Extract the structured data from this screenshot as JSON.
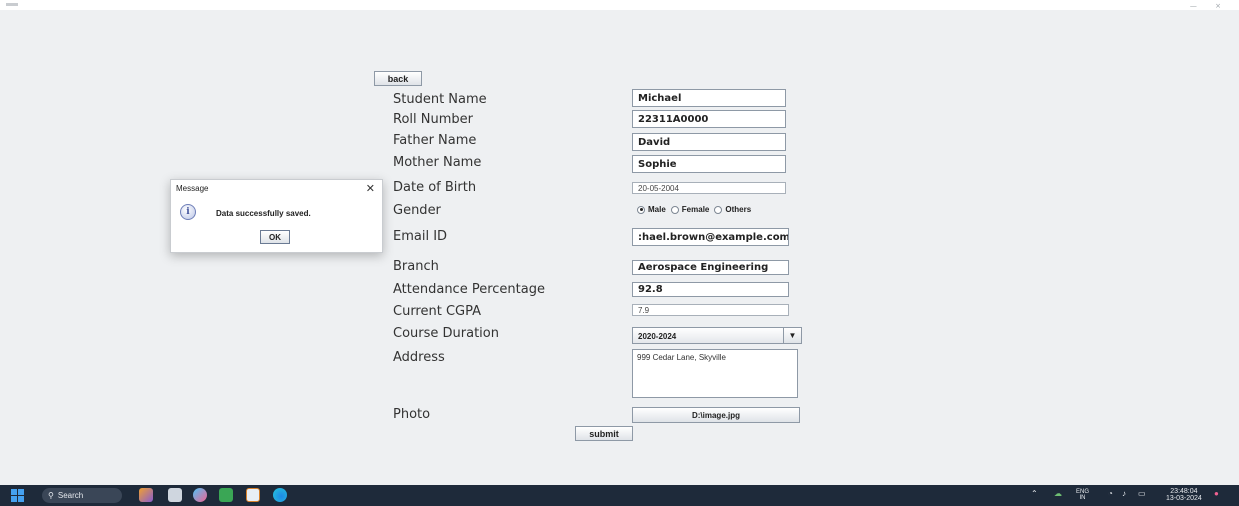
{
  "form": {
    "back_label": "back",
    "labels": {
      "student_name": "Student Name",
      "roll_number": "Roll Number",
      "father_name": "Father Name",
      "mother_name": "Mother Name",
      "dob": "Date of Birth",
      "gender": "Gender",
      "email": "Email ID",
      "branch": "Branch",
      "attendance": "Attendance Percentage",
      "cgpa": "Current CGPA",
      "duration": "Course Duration",
      "address": "Address",
      "photo": "Photo"
    },
    "values": {
      "student_name": "Michael",
      "roll_number": "22311A0000",
      "father_name": "David",
      "mother_name": "Sophie",
      "dob": "20-05-2004",
      "email": ":hael.brown@example.com",
      "branch": "Aerospace Engineering",
      "attendance": "92.8",
      "cgpa": "7.9",
      "duration": "2020-2024",
      "address": "999 Cedar Lane, Skyville",
      "photo_path": "D:\\image.jpg"
    },
    "gender_options": [
      "Male",
      "Female",
      "Others"
    ],
    "gender_selected": "Male",
    "submit_label": "submit"
  },
  "dialog": {
    "title": "Message",
    "message": "Data successfully saved.",
    "ok_label": "OK",
    "icon": "info-icon"
  },
  "taskbar": {
    "search_label": "Search",
    "lang_top": "ENG",
    "lang_bottom": "IN",
    "time": "23:48:04",
    "date": "13-03-2024"
  },
  "colors": {
    "background": "#eef0f2",
    "taskbar": "#1e2a3a",
    "start_accent": "#45a1f0"
  }
}
